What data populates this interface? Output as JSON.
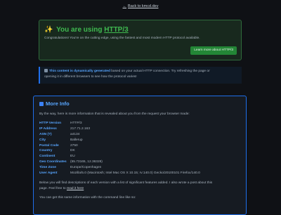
{
  "back_link": {
    "arrow": "←",
    "text": "Back to kmcd.dev"
  },
  "success": {
    "icon": "✨",
    "title_prefix": "You are using",
    "protocol": "HTTP/3",
    "description": "Congratulations! You're on the cutting edge, using the fastest and most modern HTTP protocol available.",
    "button": "Learn more about HTTP/3"
  },
  "notice": {
    "highlight": "This content is dynamically generated",
    "rest_line1": "based on your actual HTTP connection. Try refreshing the page or",
    "line2": "opening it in different browsers to see how the protocol varies!"
  },
  "more_info": {
    "title": "More Info",
    "intro": "By the way, here is more information that is revealed about you from the request your browser made:",
    "rows": [
      {
        "key": "HTTP Version",
        "value": "HTTP/3"
      },
      {
        "key": "IP Address",
        "value": "217.71.2.163"
      },
      {
        "key": "ASN (?)",
        "value": "a4134"
      },
      {
        "key": "City",
        "value": "Ballerup"
      },
      {
        "key": "Postal Code",
        "value": "2750"
      },
      {
        "key": "Country",
        "value": "DK"
      },
      {
        "key": "Continent",
        "value": "EU"
      },
      {
        "key": "Geo Coordinates",
        "value": "(55.73165, 12.36328)"
      },
      {
        "key": "Time Zone",
        "value": "Europe/Copenhagen"
      },
      {
        "key": "User Agent",
        "value": "Mozilla/5.0 (Macintosh; Intel Mac OS X 10.15; rv:140.0) Gecko/20100101 Firefox/140.0"
      }
    ],
    "paragraph_line1": "Below you will find descriptions of each version with a list of significant features added. I also wrote a post about this",
    "paragraph_line2_prefix": "page. Feel free to",
    "paragraph_link": "read it here",
    "command_line": "You can get this same information with the command line like so:"
  },
  "colors": {
    "accent": "#58a6ff",
    "success": "#3fb950",
    "button": "#238636",
    "background": "#0f1115"
  }
}
